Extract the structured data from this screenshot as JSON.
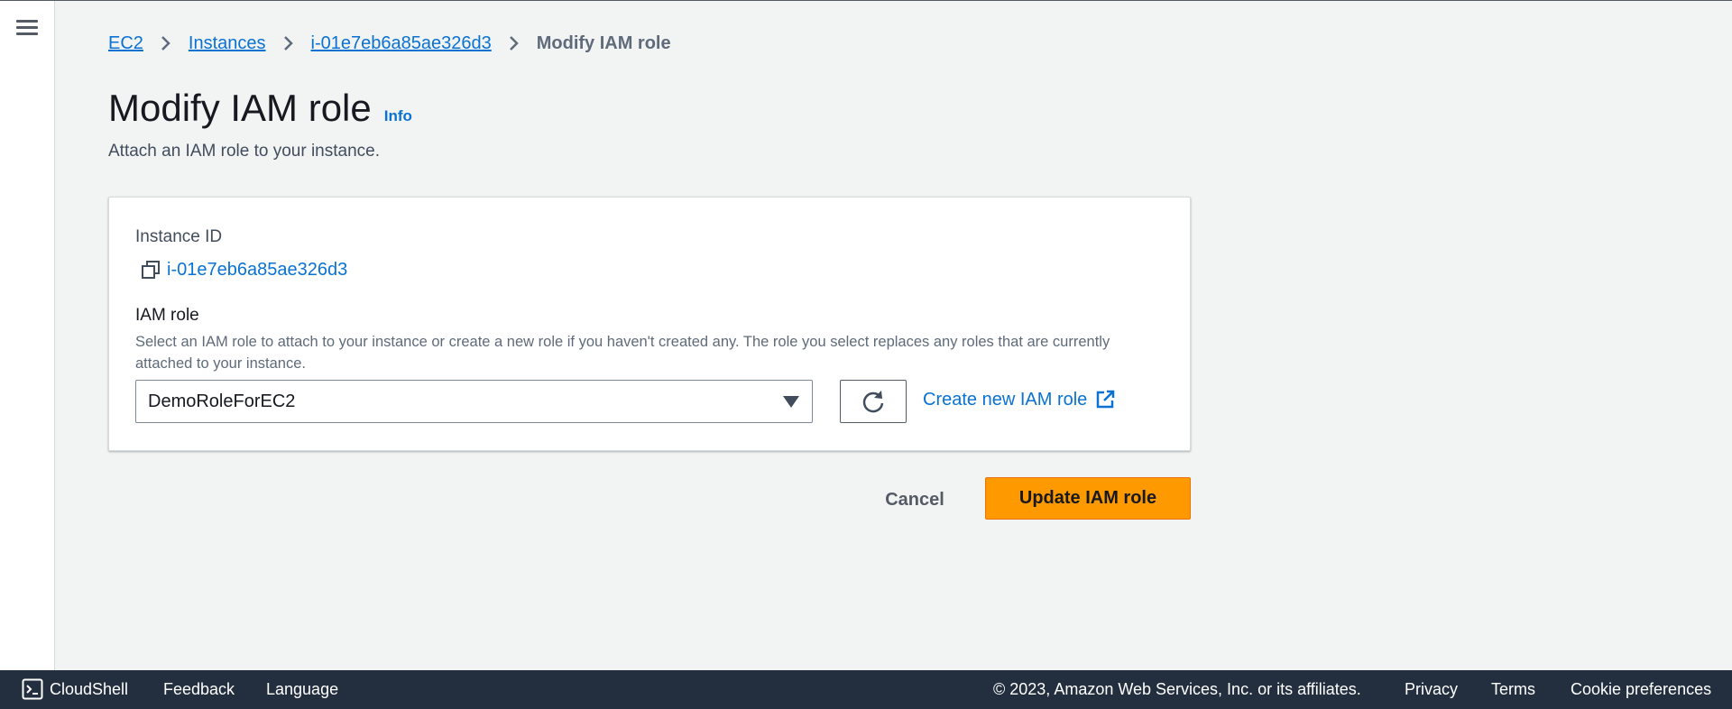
{
  "breadcrumb": {
    "items": [
      "EC2",
      "Instances",
      "i-01e7eb6a85ae326d3"
    ],
    "current": "Modify IAM role"
  },
  "page": {
    "title": "Modify IAM role",
    "info": "Info",
    "description": "Attach an IAM role to your instance."
  },
  "instance": {
    "label": "Instance ID",
    "value": "i-01e7eb6a85ae326d3"
  },
  "iam_role": {
    "label": "IAM role",
    "description": "Select an IAM role to attach to your instance or create a new role if you haven't created any. The role you select replaces any roles that are currently attached to your instance.",
    "selected": "DemoRoleForEC2",
    "create_link": "Create new IAM role"
  },
  "actions": {
    "cancel": "Cancel",
    "submit": "Update IAM role"
  },
  "footer": {
    "cloudshell": "CloudShell",
    "feedback": "Feedback",
    "language": "Language",
    "copyright": "© 2023, Amazon Web Services, Inc. or its affiliates.",
    "privacy": "Privacy",
    "terms": "Terms",
    "cookies": "Cookie preferences"
  },
  "colors": {
    "link": "#0972d3",
    "primary_button": "#ff9900",
    "footer_bg": "#232f3e",
    "page_bg": "#f2f3f3"
  },
  "icons": [
    "menu-icon",
    "chevron-right-icon",
    "copy-icon",
    "caret-down-icon",
    "refresh-icon",
    "external-link-icon",
    "cloudshell-icon"
  ]
}
